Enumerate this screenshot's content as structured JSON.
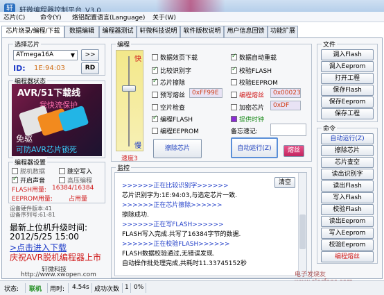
{
  "window": {
    "title": "轩微编程器控制平台_V3.0"
  },
  "menu": [
    "芯片(C)",
    "命令(Y)",
    "烙铝配置语言(Language)",
    "关于(W)"
  ],
  "tabs": [
    "芯片烧录/编程/下载",
    "数据编辑",
    "编程器测试",
    "轩微科技说明",
    "软件版权说明",
    "用户信息回馈",
    "功能扩展"
  ],
  "chip_select": {
    "title": "选择芯片",
    "chip_value": "ATmega16A",
    "more_button": ">>",
    "id_label": "ID:",
    "id_value": "1E:94:03",
    "rd_button": "RD"
  },
  "programmer_status": {
    "title": "编程器状态",
    "banner_line1": "AVR/51下载线",
    "banner_line2": "我快流保护",
    "promo_line1": "免驱",
    "promo_line2": "可防AVR芯片锁死"
  },
  "programmer_settings": {
    "title": "编程器设置",
    "options": [
      {
        "label": "脱机数据",
        "checked": false
      },
      {
        "label": "跳空写入",
        "checked": false
      },
      {
        "label": "开启声音",
        "checked": true
      },
      {
        "label": "高压编程",
        "checked": false
      }
    ],
    "flash_usage_label": "FLASH用量:",
    "flash_usage_value": "16384/16384",
    "eeprom_usage_label": "EEPROM用量:",
    "eeprom_usage_value": "占用量",
    "hw_version": "设备硬件版本:41",
    "fw_version": "设备序列号:61-81"
  },
  "upgrade": {
    "title": "最新上位机升级时间:",
    "date": "2012/5/25  15:00",
    "link": ">点击进入下载",
    "slogan": "庆祝AVR脱机编程器上市"
  },
  "company": {
    "name": "轩微科技",
    "url": "http://www.xwopen.com"
  },
  "programming": {
    "title": "编程",
    "speed_fast": "快",
    "speed_slow": "慢",
    "speed_level": 0.35,
    "speed_label": "速度3",
    "left_options": [
      {
        "label": "数据效页下载",
        "checked": false
      },
      {
        "label": "比较识别字",
        "checked": true
      },
      {
        "label": "芯片擦除",
        "checked": true
      },
      {
        "label": "预写熔丝",
        "checked": false
      },
      {
        "label": "空片检查",
        "checked": false
      },
      {
        "label": "编程FLASH",
        "checked": true
      },
      {
        "label": "编程EEPROM",
        "checked": false
      }
    ],
    "right_options": [
      {
        "label": "数据自动重载",
        "checked": true
      },
      {
        "label": "校验FLASH",
        "checked": true
      },
      {
        "label": "校验EEPROM",
        "checked": false
      },
      {
        "label": "编程熔丝",
        "checked": false
      },
      {
        "label": "加密芯片",
        "checked": false
      },
      {
        "label": "提供时钟",
        "checked": false
      }
    ],
    "prewrite_value": "0xFF99E",
    "fuse_value": "0x00023",
    "lock_value": "0xDF",
    "memo_label": "备忘速记:",
    "erase_button": "擦除芯片",
    "auto_run_button": "自动运行(Z)",
    "fuse_button": "熔丝"
  },
  "monitor": {
    "title": "监控",
    "clear_button": "清空",
    "lines": [
      {
        "text": ">>>>>>正在比较识别字>>>>>>",
        "style": "blue"
      },
      {
        "text": "芯片识别字为:1E:94:03,与选定芯片一致.",
        "style": "norm"
      },
      {
        "text": ">>>>>>正在芯片擦除>>>>>>",
        "style": "blue"
      },
      {
        "text": "擦除成功.",
        "style": "norm"
      },
      {
        "text": ">>>>>>正在写FLASH>>>>>>",
        "style": "blue"
      },
      {
        "text": "FLASH写入完成.共写了16384字节的数据.",
        "style": "norm"
      },
      {
        "text": ">>>>>>正在校验FLASH>>>>>>",
        "style": "blue"
      },
      {
        "text": "FLASH数据校验通过,无错误发现.",
        "style": "norm"
      },
      {
        "text": "自动操作批处理完成,共耗时11.33745152秒",
        "style": "norm"
      }
    ]
  },
  "file_panel": {
    "title": "文件",
    "buttons": [
      "调入Flash",
      "调入Eeprom",
      "打开工程",
      "保存Flash",
      "保存Eeprom",
      "保存工程"
    ]
  },
  "command_panel": {
    "title": "命令",
    "buttons": [
      "自动运行(Z)",
      "擦除芯片",
      "芯片查空",
      "读出识别字",
      "读出Flash",
      "写入Flash",
      "校验Flash",
      "读出Eeprom",
      "写入Eeprom",
      "校验Eeprom",
      "编程熔丝"
    ]
  },
  "status": {
    "label": "状态:",
    "conn": "联机",
    "time_label": "用时:",
    "time_value": "4.54s",
    "success_label": "成功次数",
    "success_value": "1",
    "pct": "0%"
  },
  "watermark": "电子发烧友 www.elecfans.com"
}
